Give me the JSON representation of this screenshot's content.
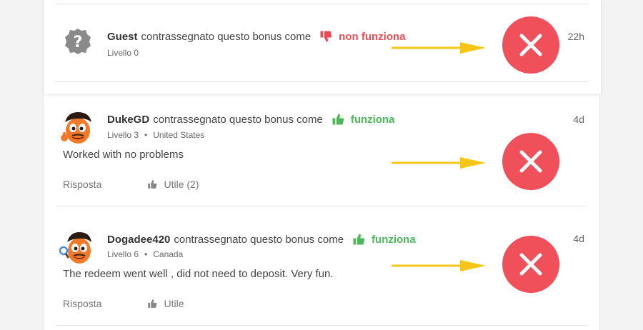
{
  "reviews": [
    {
      "user": "Guest",
      "action_text": "contrassegnato questo bonus come",
      "verdict": "non funziona",
      "verdict_type": "bad",
      "level": "Livello 0",
      "country": "",
      "time": "22h",
      "comment": "",
      "avatar_icon": "guest-question-icon"
    },
    {
      "user": "DukeGD",
      "action_text": "contrassegnato questo bonus come",
      "verdict": "funziona",
      "verdict_type": "good",
      "level": "Livello 3",
      "country": "United States",
      "time": "4d",
      "comment": "Worked with no problems",
      "reply_label": "Risposta",
      "useful_label": "Utile (2)",
      "avatar_icon": "cartoon-avatar"
    },
    {
      "user": "Dogadee420",
      "action_text": "contrassegnato questo bonus come",
      "verdict": "funziona",
      "verdict_type": "good",
      "level": "Livello 6",
      "country": "Canada",
      "time": "4d",
      "comment": "The redeem went well , did not need to deposit. Very fun.",
      "reply_label": "Risposta",
      "useful_label": "Utile",
      "avatar_icon": "cartoon-avatar"
    }
  ],
  "colors": {
    "bad": "#e84d57",
    "good": "#4cb85a",
    "arrow": "#f5c518",
    "x_circle": "#f0505a"
  },
  "annotations": {
    "arrow_icon": "yellow-arrow-icon",
    "mark_icon": "red-x-circle-icon"
  }
}
